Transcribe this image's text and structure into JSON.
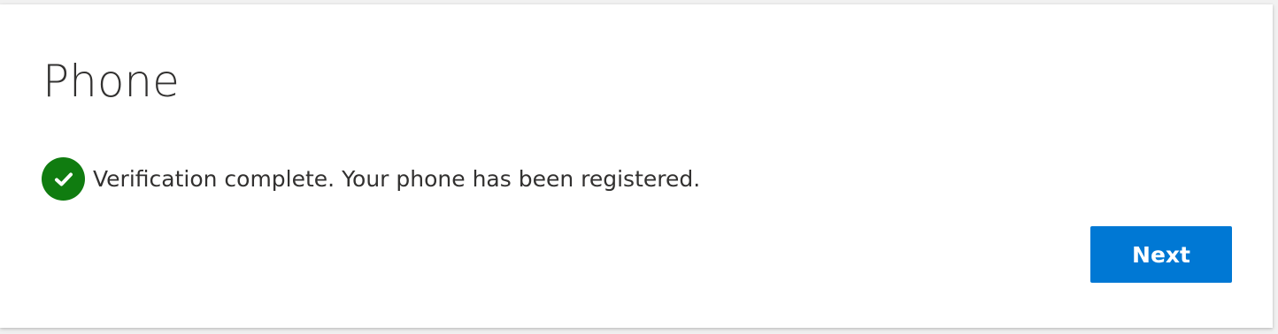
{
  "page": {
    "title": "Phone"
  },
  "status": {
    "icon": "checkmark-circle-icon",
    "message": "Verification complete. Your phone has been registered."
  },
  "actions": {
    "next_label": "Next"
  },
  "colors": {
    "accent": "#0078d4",
    "success": "#107c10"
  }
}
